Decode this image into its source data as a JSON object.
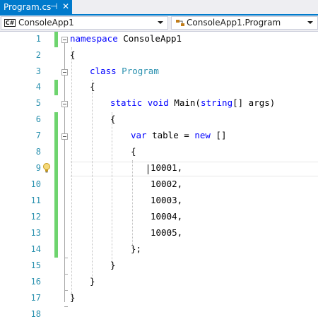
{
  "tab": {
    "title": "Program.cs",
    "pin_glyph": "⊣",
    "close_glyph": "✕"
  },
  "navbar": {
    "project": "ConsoleApp1",
    "project_badge": "C#",
    "member": "ConsoleApp1.Program"
  },
  "editor": {
    "line_numbers": [
      "1",
      "2",
      "3",
      "4",
      "5",
      "6",
      "7",
      "8",
      "9",
      "10",
      "11",
      "12",
      "13",
      "14",
      "15",
      "16",
      "17",
      "18"
    ],
    "lines": {
      "l1": {
        "keyword": "namespace",
        "rest": " ConsoleApp1"
      },
      "l2": {
        "text": "{"
      },
      "l3": {
        "keyword": "class",
        "type": "Program"
      },
      "l4": {
        "text": "{"
      },
      "l5": {
        "keyword1": "static",
        "keyword2": "void",
        "mid": " Main(",
        "keyword3": "string",
        "rest": "[] args)"
      },
      "l6": {
        "text": "{"
      },
      "l7": {
        "keyword1": "var",
        "mid": " table = ",
        "keyword2": "new",
        "rest": " []"
      },
      "l8": {
        "text": "{"
      },
      "l9": {
        "text": "10001,"
      },
      "l10": {
        "text": "10002,"
      },
      "l11": {
        "text": "10003,"
      },
      "l12": {
        "text": "10004,"
      },
      "l13": {
        "text": "10005,"
      },
      "l14": {
        "text": "};"
      },
      "l15": {
        "text": "}"
      },
      "l16": {
        "text": "}"
      },
      "l17": {
        "text": "}"
      }
    },
    "accent_colors": {
      "keyword": "#0000ff",
      "type": "#2b91af",
      "changed": "#6ed46e",
      "tab": "#007acc"
    }
  }
}
